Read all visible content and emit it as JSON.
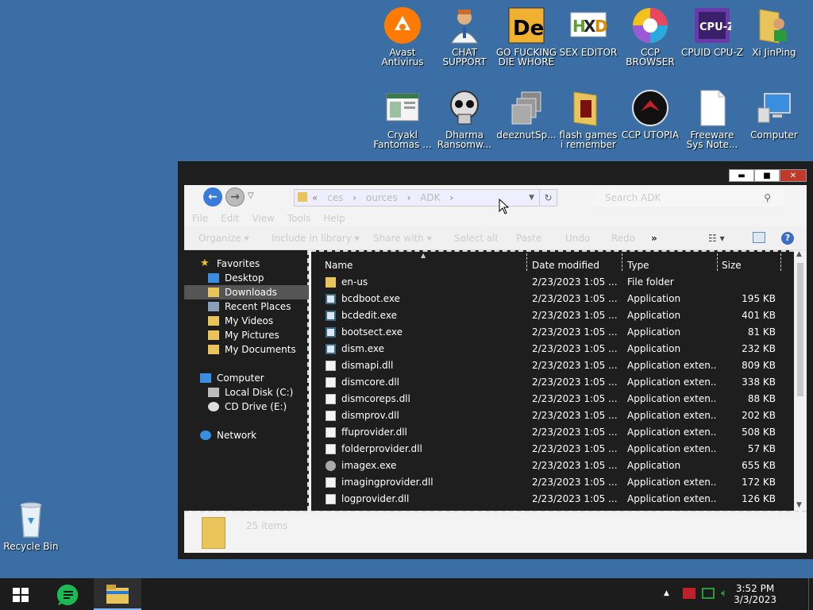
{
  "desktop": {
    "icons": [
      {
        "label": "Avast Antivirus"
      },
      {
        "label": "CHAT SUPPORT"
      },
      {
        "label": "GO FUCKING DIE WHORE"
      },
      {
        "label": "SEX EDITOR"
      },
      {
        "label": "CCP BROWSER"
      },
      {
        "label": "CPUID CPU-Z"
      },
      {
        "label": "Xi JinPing"
      },
      {
        "label": "Cryakl Fantomas ..."
      },
      {
        "label": "Dharma Ransomw..."
      },
      {
        "label": "deeznutSp..."
      },
      {
        "label": "flash games i remember"
      },
      {
        "label": "CCP UTOPIA"
      },
      {
        "label": "Freeware Sys Note..."
      },
      {
        "label": "Computer"
      },
      {
        "label": "Recycle Bin"
      }
    ]
  },
  "window": {
    "controls": {
      "minimize": "▬",
      "maximize": "■",
      "close": "✕"
    },
    "address": {
      "sep": "«",
      "path": [
        "ces",
        "ources",
        "ADK"
      ]
    },
    "search_placeholder": "Search ADK",
    "menu": [
      "File",
      "Edit",
      "View",
      "Tools",
      "Help"
    ],
    "toolbar": {
      "organize": "Organize ▾",
      "include": "Include in library ▾",
      "share": "Share with ▾",
      "select_all": "Select all",
      "paste": "Paste",
      "undo": "Undo",
      "redo": "Redo",
      "more": "»"
    },
    "nav": {
      "favorites": "Favorites",
      "desktop": "Desktop",
      "downloads": "Downloads",
      "recent": "Recent Places",
      "videos": "My Videos",
      "pictures": "My Pictures",
      "documents": "My Documents",
      "computer": "Computer",
      "local_disk": "Local Disk (C:)",
      "cd_drive": "CD Drive (E:)",
      "network": "Network"
    },
    "columns": {
      "name": "Name",
      "date": "Date modified",
      "type": "Type",
      "size": "Size"
    },
    "files": [
      {
        "name": "en-us",
        "date": "2/23/2023 1:05 ...",
        "type": "File folder",
        "size": "",
        "icon": "folder"
      },
      {
        "name": "bcdboot.exe",
        "date": "2/23/2023 1:05 ...",
        "type": "Application",
        "size": "195 KB",
        "icon": "exe"
      },
      {
        "name": "bcdedit.exe",
        "date": "2/23/2023 1:05 ...",
        "type": "Application",
        "size": "401 KB",
        "icon": "exe"
      },
      {
        "name": "bootsect.exe",
        "date": "2/23/2023 1:05 ...",
        "type": "Application",
        "size": "81 KB",
        "icon": "exe"
      },
      {
        "name": "dism.exe",
        "date": "2/23/2023 1:05 ...",
        "type": "Application",
        "size": "232 KB",
        "icon": "exe"
      },
      {
        "name": "dismapi.dll",
        "date": "2/23/2023 1:05 ...",
        "type": "Application exten...",
        "size": "809 KB",
        "icon": "dll"
      },
      {
        "name": "dismcore.dll",
        "date": "2/23/2023 1:05 ...",
        "type": "Application exten...",
        "size": "338 KB",
        "icon": "dll"
      },
      {
        "name": "dismcoreps.dll",
        "date": "2/23/2023 1:05 ...",
        "type": "Application exten...",
        "size": "88 KB",
        "icon": "dll"
      },
      {
        "name": "dismprov.dll",
        "date": "2/23/2023 1:05 ...",
        "type": "Application exten...",
        "size": "202 KB",
        "icon": "dll"
      },
      {
        "name": "ffuprovider.dll",
        "date": "2/23/2023 1:05 ...",
        "type": "Application exten...",
        "size": "508 KB",
        "icon": "dll"
      },
      {
        "name": "folderprovider.dll",
        "date": "2/23/2023 1:05 ...",
        "type": "Application exten...",
        "size": "57 KB",
        "icon": "dll"
      },
      {
        "name": "imagex.exe",
        "date": "2/23/2023 1:05 ...",
        "type": "Application",
        "size": "655 KB",
        "icon": "exe2"
      },
      {
        "name": "imagingprovider.dll",
        "date": "2/23/2023 1:05 ...",
        "type": "Application exten...",
        "size": "172 KB",
        "icon": "dll"
      },
      {
        "name": "logprovider.dll",
        "date": "2/23/2023 1:05 ...",
        "type": "Application exten...",
        "size": "126 KB",
        "icon": "dll"
      }
    ],
    "status": "25 items"
  },
  "taskbar": {
    "time": "3:52 PM",
    "date": "3/3/2023"
  },
  "colors": {
    "desktop": "#3a6ea5",
    "window_dark": "#1e1e1e",
    "close": "#c0392b",
    "folder": "#e8c45a",
    "taskbar": "#1c1c1c"
  }
}
